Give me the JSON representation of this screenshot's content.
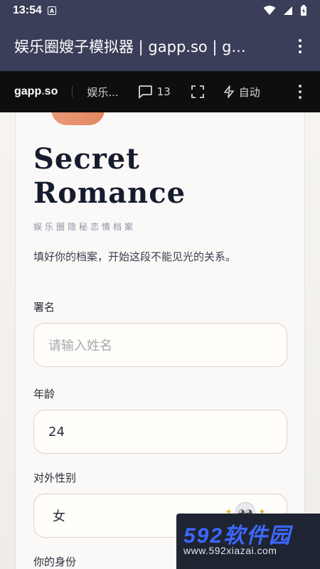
{
  "status_bar": {
    "time": "13:54",
    "a_badge": "A"
  },
  "titlebar": {
    "title": "娱乐圈嫂子模拟器 | gapp.so | g..."
  },
  "toolbar": {
    "brand_left": "gapp",
    "brand_dot": ".",
    "brand_right": "so",
    "crumb": "娱乐...",
    "comments_count": "13",
    "auto_label": "自动"
  },
  "hero": {
    "title_line1": "Secret",
    "title_line2": "Romance",
    "subtitle": "娱乐圈隐秘恋情档案",
    "description": "填好你的档案，开始这段不能见光的关系。"
  },
  "form": {
    "name_label": "署名",
    "name_placeholder": "请输入姓名",
    "age_label": "年龄",
    "age_value": "24",
    "gender_label": "对外性别",
    "gender_value": "女",
    "identity_label": "你的身份"
  },
  "watermark": {
    "brand": "592软件园",
    "url": "www.592xiazai.com"
  },
  "colors": {
    "header_bg": "#3a3e58",
    "toolbar_bg": "#0e0e0f",
    "title_ink": "#161b2e",
    "field_border": "#dcd3c3"
  }
}
